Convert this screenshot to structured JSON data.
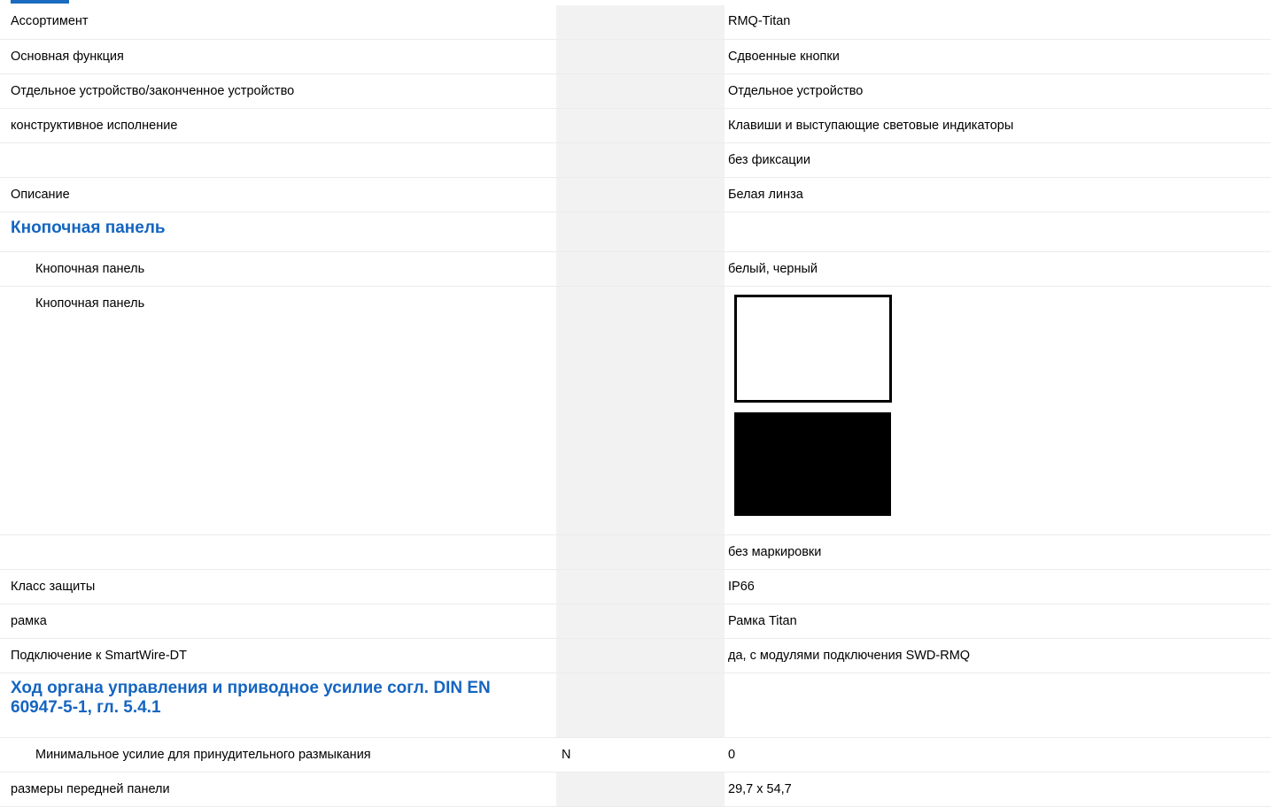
{
  "rows": [
    {
      "label": "Ассортимент",
      "unit": "",
      "value": "RMQ-Titan"
    },
    {
      "label": "Основная функция",
      "unit": "",
      "value": "Сдвоенные кнопки"
    },
    {
      "label": "Отдельное устройство/законченное устройство",
      "unit": "",
      "value": "Отдельное устройство"
    },
    {
      "label": "конструктивное исполнение",
      "unit": "",
      "value": "Клавиши и выступающие световые индикаторы"
    },
    {
      "label": "",
      "unit": "",
      "value": "без фиксации"
    },
    {
      "label": "Описание",
      "unit": "",
      "value": "Белая линза"
    }
  ],
  "section_button_panel": {
    "heading": "Кнопочная панель",
    "rows": [
      {
        "label": "Кнопочная панель",
        "value": "белый, черный"
      },
      {
        "label": "Кнопочная панель",
        "value": "",
        "swatches": [
          "#ffffff",
          "#000000"
        ]
      }
    ]
  },
  "rows2": [
    {
      "label": "",
      "value": "без маркировки"
    },
    {
      "label": "Класс защиты",
      "value": "IP66"
    },
    {
      "label": "рамка",
      "value": "Рамка Titan"
    },
    {
      "label": "Подключение к SmartWire-DT",
      "value": "да, с модулями подключения SWD-RMQ"
    }
  ],
  "section_travel": {
    "heading": "Ход органа управления и приводное усилие согл. DIN EN 60947-5-1, гл. 5.4.1",
    "rows": [
      {
        "label": "Минимальное усилие для принудительного размыкания",
        "unit": "N",
        "value": "0"
      }
    ]
  },
  "rows3": [
    {
      "label": "размеры передней панели",
      "value": "29,7 x 54,7"
    }
  ],
  "colors": {
    "heading": "#1565c0",
    "shade": "#f2f2f2"
  }
}
